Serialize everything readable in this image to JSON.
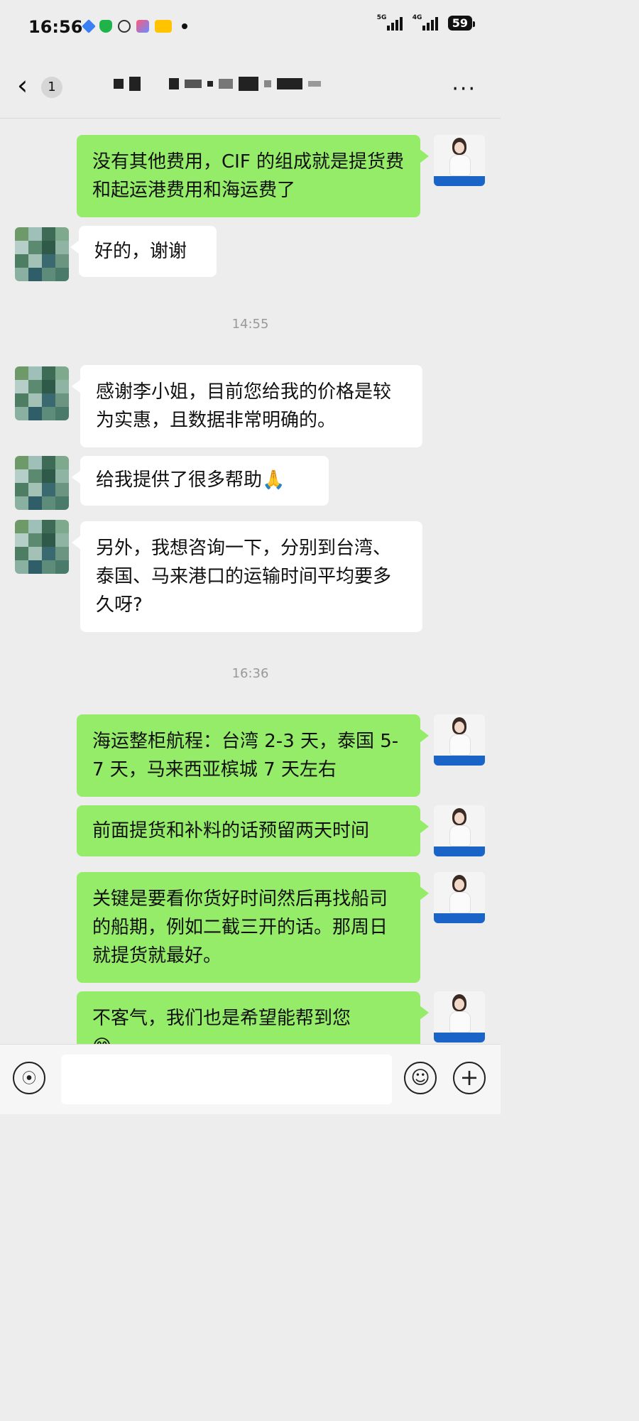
{
  "status_bar": {
    "time": "16:56",
    "icons": [
      "send-icon",
      "shield-icon",
      "chat-icon",
      "app-icon",
      "meituan-icon"
    ],
    "signal_1_label": "5G",
    "signal_2_label": "4G",
    "battery": "59"
  },
  "nav": {
    "back_icon": "chevron-left-icon",
    "unread_count": "1",
    "title_obscured": true,
    "more_label": "···"
  },
  "messages": [
    {
      "id": "m1",
      "side": "out",
      "text": "没有其他费用，CIF 的组成就是提货费和起运港费用和海运费了"
    },
    {
      "id": "m2",
      "side": "in",
      "text": "好的，谢谢"
    },
    {
      "id": "t1",
      "type": "timestamp",
      "text": "14:55"
    },
    {
      "id": "m3",
      "side": "in",
      "text": "感谢李小姐，目前您给我的价格是较为实惠，且数据非常明确的。"
    },
    {
      "id": "m4",
      "side": "in",
      "text": "给我提供了很多帮助",
      "emoji": "🙏"
    },
    {
      "id": "m5",
      "side": "in",
      "text": "另外，我想咨询一下，分别到台湾、泰国、马来港口的运输时间平均要多久呀?"
    },
    {
      "id": "t2",
      "type": "timestamp",
      "text": "16:36"
    },
    {
      "id": "m6",
      "side": "out",
      "text": "海运整柜航程：台湾 2-3 天，泰国 5-7 天，马来西亚槟城 7 天左右"
    },
    {
      "id": "m7",
      "side": "out",
      "text": "前面提货和补料的话预留两天时间"
    },
    {
      "id": "m8",
      "side": "out",
      "text": "关键是要看你货好时间然后再找船司的船期，例如二截三开的话。那周日就提货就最好。"
    },
    {
      "id": "m9",
      "side": "out",
      "text": "不客气，我们也是希望能帮到您",
      "emoji": "😊"
    }
  ],
  "input_bar": {
    "voice_icon": "voice-icon",
    "input_value": "",
    "emoji_icon": "emoji-icon",
    "plus_icon": "plus-icon"
  },
  "colors": {
    "background": "#ededed",
    "outgoing_bubble": "#95ec69",
    "incoming_bubble": "#ffffff",
    "timestamp": "#999999"
  }
}
